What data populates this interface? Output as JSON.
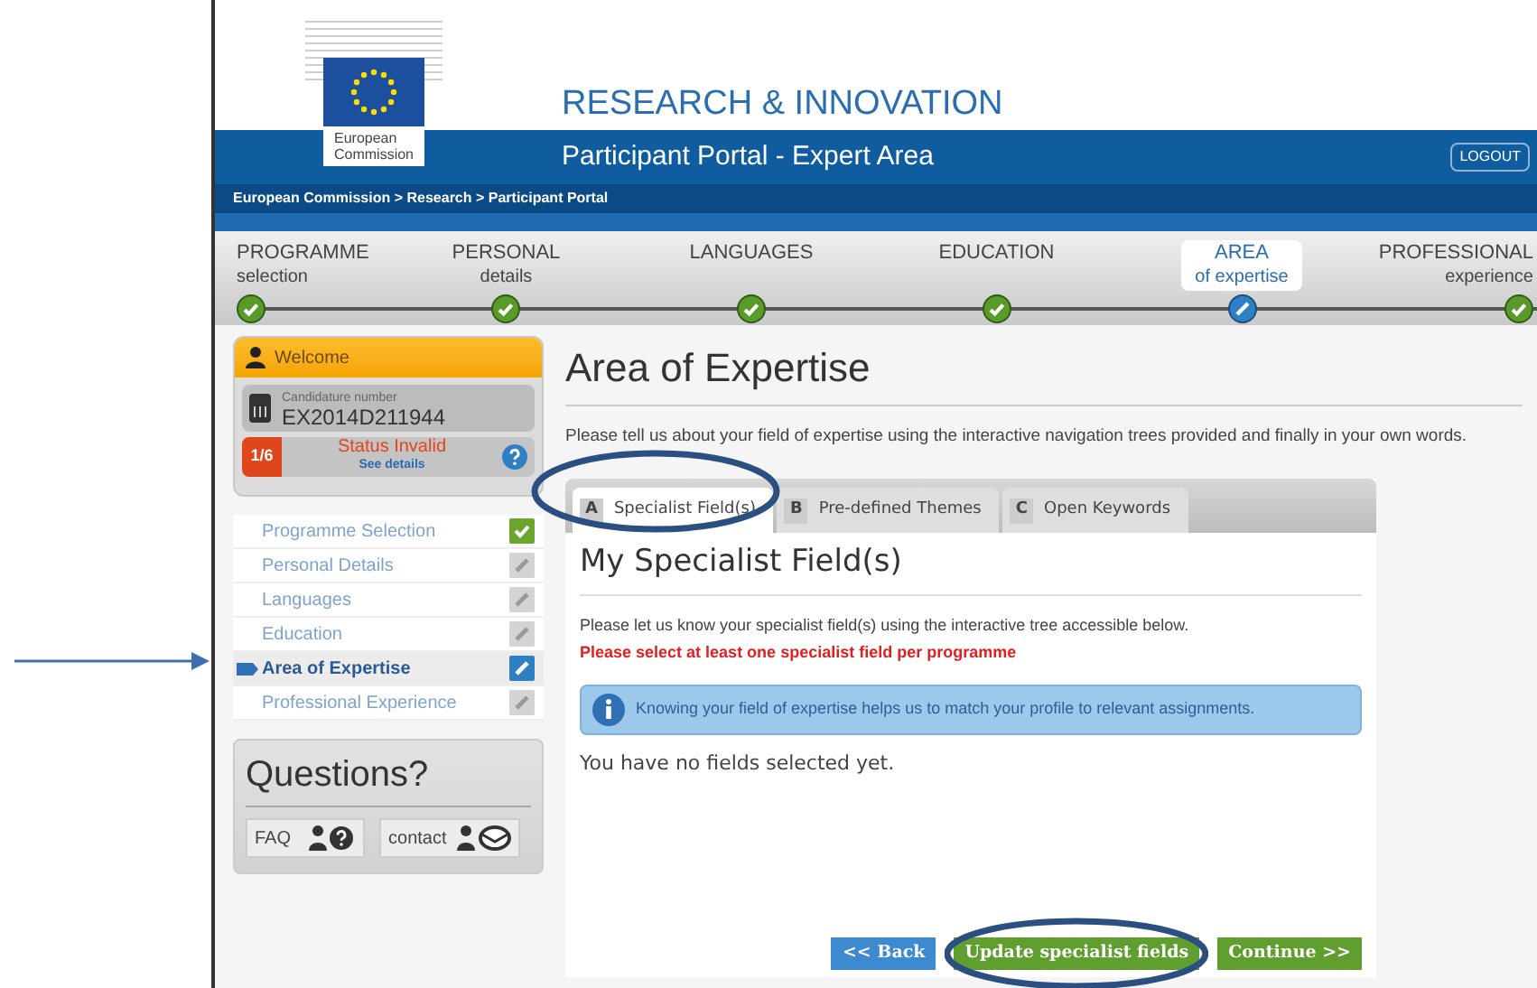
{
  "header": {
    "logo_text": "European Commission",
    "title": "RESEARCH & INNOVATION",
    "subtitle": "Participant Portal - Expert Area",
    "logout": "LOGOUT",
    "breadcrumb": "European Commission > Research > Participant Portal"
  },
  "steps": [
    {
      "label": "PROGRAMME",
      "sub": "selection",
      "kind": "done",
      "selected": false
    },
    {
      "label": "PERSONAL",
      "sub": "details",
      "kind": "done",
      "selected": false
    },
    {
      "label": "LANGUAGES",
      "kind": "done",
      "selected": false
    },
    {
      "label": "EDUCATION",
      "kind": "done",
      "selected": false
    },
    {
      "label": "AREA",
      "sub": "of expertise",
      "kind": "current",
      "selected": true
    },
    {
      "label": "PROFESSIONAL",
      "sub": "experience",
      "kind": "done",
      "selected": false
    }
  ],
  "sidebar": {
    "welcome": "Welcome",
    "candidature_label": "Candidature number",
    "candidature_number": "EX2014D211944",
    "progress": "1/6",
    "status": "Status Invalid",
    "status_link": "See details",
    "items": [
      {
        "label": "Programme Selection",
        "kind": "done",
        "selected": false
      },
      {
        "label": "Personal Details",
        "kind": "todo",
        "selected": false
      },
      {
        "label": "Languages",
        "kind": "todo",
        "selected": false
      },
      {
        "label": "Education",
        "kind": "todo",
        "selected": false
      },
      {
        "label": "Area of Expertise",
        "kind": "current",
        "selected": true
      },
      {
        "label": "Professional Experience",
        "kind": "todo",
        "selected": false
      }
    ],
    "questions": {
      "title": "Questions?",
      "faq": "FAQ",
      "contact": "contact"
    }
  },
  "main": {
    "title": "Area of Expertise",
    "intro": "Please tell us about your field of expertise using the interactive navigation trees provided and finally in your own words.",
    "tabs": [
      {
        "letter": "A",
        "label": "Specialist Field(s)",
        "selected": true
      },
      {
        "letter": "B",
        "label": "Pre-defined Themes",
        "selected": false
      },
      {
        "letter": "C",
        "label": "Open Keywords",
        "selected": false
      }
    ],
    "panel_title": "My Specialist Field(s)",
    "instruction": "Please let us know your specialist field(s) using the interactive tree accessible below.",
    "warning": "Please select at least one specialist field per programme",
    "info": "Knowing your field of expertise helps us to match your profile to relevant assignments.",
    "empty": "You have no fields selected yet.",
    "buttons": [
      {
        "label": "<< Back",
        "kind": "back"
      },
      {
        "label": "Update specialist fields",
        "kind": "action"
      },
      {
        "label": "Continue >>",
        "kind": "action"
      }
    ]
  }
}
